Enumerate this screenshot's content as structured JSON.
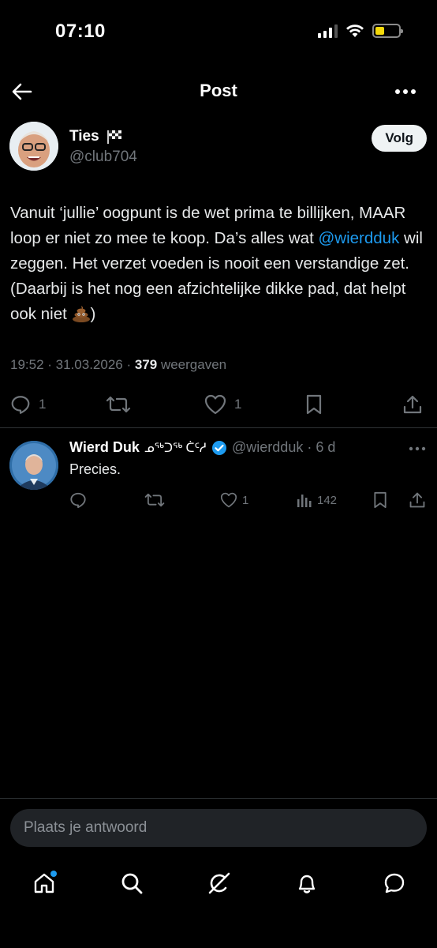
{
  "status_bar": {
    "time": "07:10",
    "icons": [
      "cellular-signal-icon",
      "wifi-icon",
      "battery-icon"
    ],
    "battery_color": "#f5d90a"
  },
  "header": {
    "title": "Post",
    "back_icon": "arrow-left-icon",
    "more_icon": "more-horizontal-icon"
  },
  "tweet": {
    "author_name": "Ties",
    "author_handle": "@club704",
    "follow_label": "Volg",
    "text_parts": {
      "p1": "Vanuit ‘jullie’ oogpunt is de wet prima te billijken, MAAR loop er niet zo mee te koop. Da’s alles wat ",
      "mention": "@wierdduk",
      "p2": " wil zeggen. Het verzet voeden is nooit een verstandige zet. (Daarbij is het nog een afzichtelijke dikke pad, dat helpt ook niet ",
      "p3": ")"
    },
    "time_date": "19:52 · 31.03.2026 · ",
    "views_count": "379",
    "views_label": " weergaven",
    "actions": {
      "reply_count": "1",
      "repost_count": "",
      "like_count": "1"
    }
  },
  "reply": {
    "name": "Wierd Duk",
    "script_name": "ᓄᖅᑐᖅ ᑖᑦᓱ",
    "handle_time": "@wierdduk · 6 d",
    "text": "Precies.",
    "actions": {
      "reply_count": "",
      "repost_count": "",
      "like_count": "1",
      "views_count": "142"
    }
  },
  "reply_bar": {
    "placeholder": "Plaats je antwoord"
  },
  "bottom_nav": {
    "items": [
      "home-icon",
      "search-icon",
      "grok-icon",
      "notifications-icon",
      "messages-icon"
    ]
  },
  "colors": {
    "accent": "#1d9bf0",
    "muted": "#71767b",
    "background": "#000000"
  }
}
